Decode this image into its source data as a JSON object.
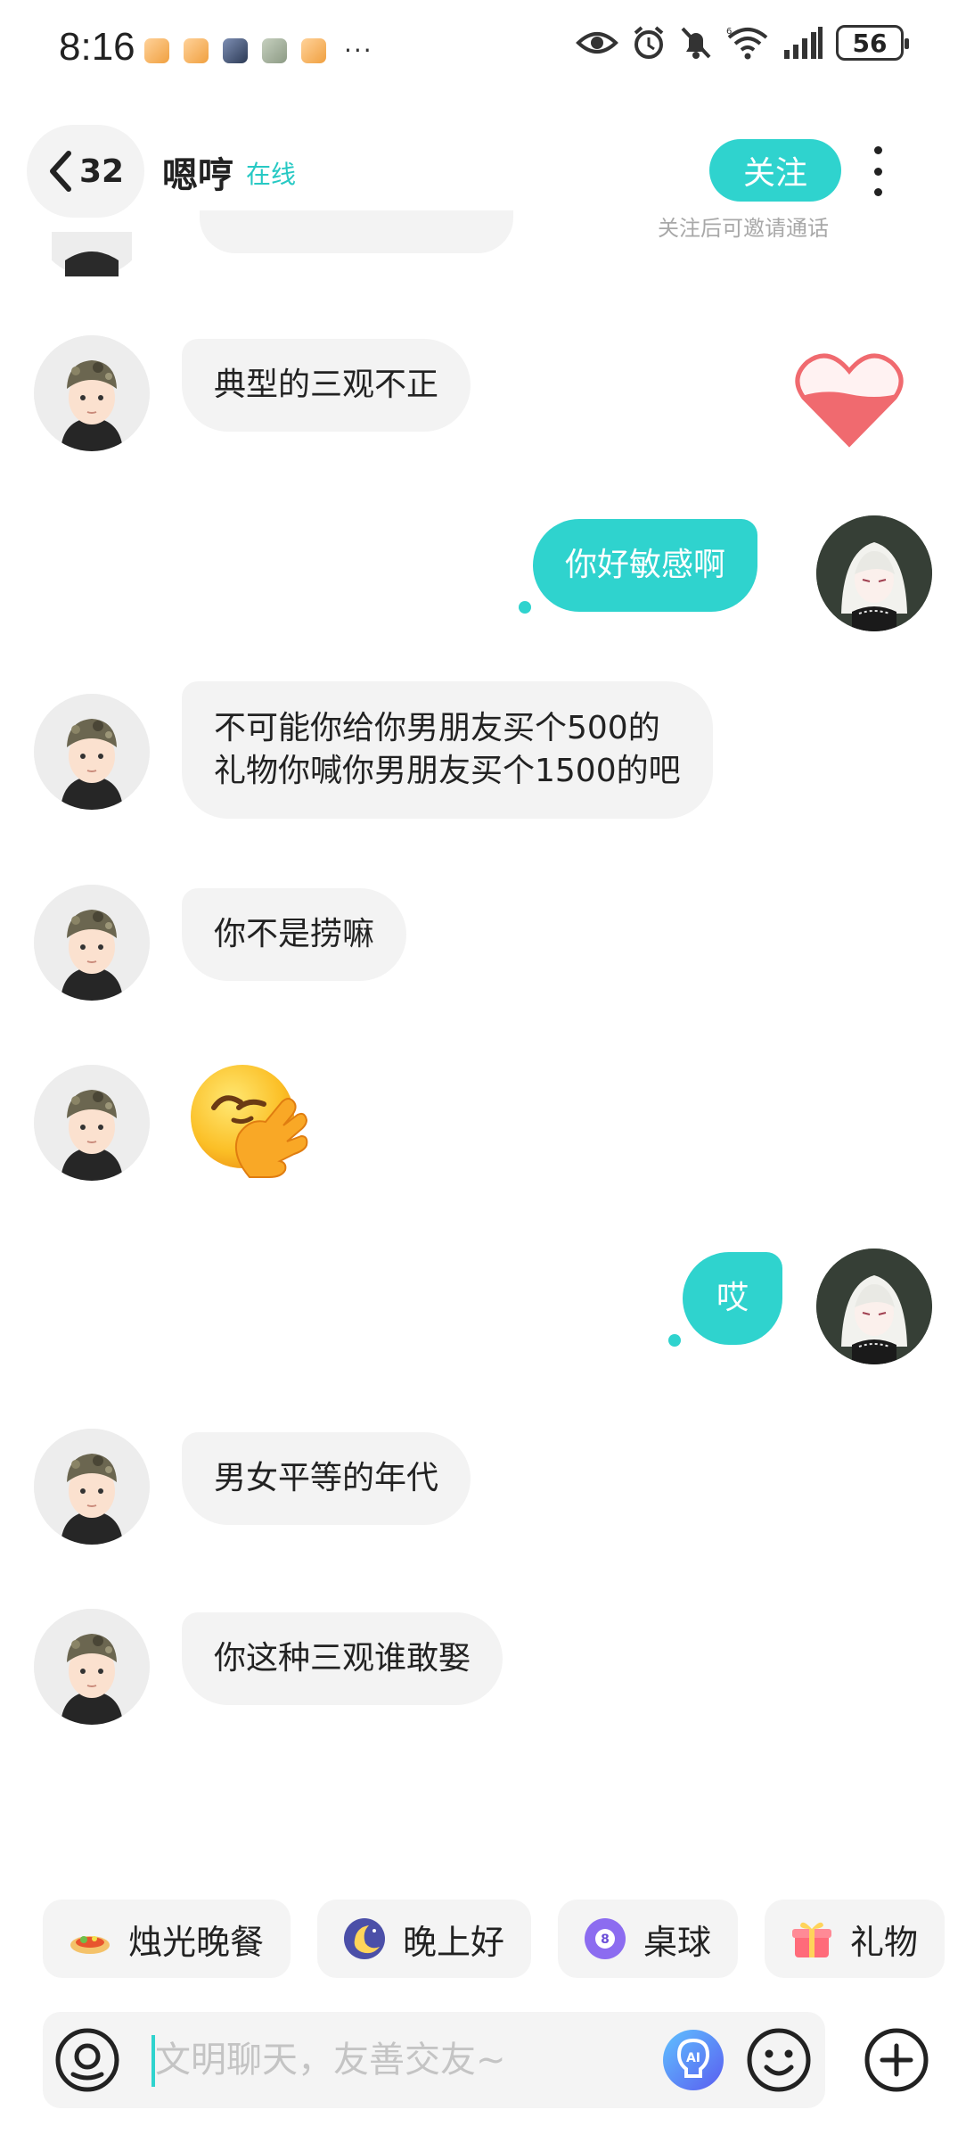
{
  "status_bar": {
    "time": "8:16",
    "more": "···",
    "battery": "56"
  },
  "header": {
    "unread_count": "32",
    "contact_name": "嗯哼",
    "online_status": "在线",
    "follow_label": "关注",
    "follow_hint": "关注后可邀请通话"
  },
  "messages": [
    {
      "direction": "in",
      "text": "典型的三观不正"
    },
    {
      "direction": "out",
      "text": "你好敏感啊"
    },
    {
      "direction": "in",
      "lines": [
        "不可能你给你男朋友买个500的",
        "礼物你喊你男朋友买个1500的吧"
      ]
    },
    {
      "direction": "in",
      "text": "你不是捞嘛"
    },
    {
      "direction": "in",
      "sticker": "face-palm-emoji"
    },
    {
      "direction": "out",
      "text": "哎"
    },
    {
      "direction": "in",
      "text": "男女平等的年代"
    },
    {
      "direction": "in",
      "text": "你这种三观谁敢娶"
    }
  ],
  "quick_actions": [
    {
      "label": "烛光晚餐",
      "icon": "dinner-icon"
    },
    {
      "label": "晚上好",
      "icon": "moon-icon"
    },
    {
      "label": "桌球",
      "icon": "billiard-ball-icon"
    },
    {
      "label": "礼物",
      "icon": "gift-icon"
    }
  ],
  "input": {
    "placeholder": "文明聊天，友善交友~"
  },
  "colors": {
    "accent": "#2fd3ce",
    "bubble_in": "#f3f3f3",
    "heart": "#f06a6f"
  }
}
